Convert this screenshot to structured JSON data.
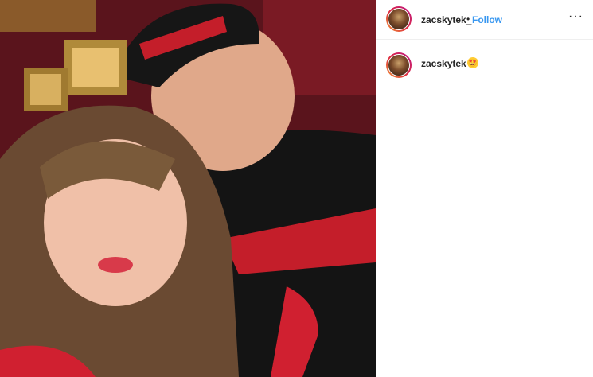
{
  "post": {
    "photo_alt": "selfie",
    "author": {
      "username": "zacskytek_",
      "separator": "•",
      "follow_label": "Follow",
      "more_icon": "more-horizontal-icon",
      "more_label": "···"
    },
    "caption": {
      "username": "zacskytek_",
      "emoji": "🤩",
      "emoji_icon": "star-struck-emoji-icon"
    },
    "colors": {
      "follow": "#3897f0",
      "text": "#262626",
      "border": "#dbdbdb"
    }
  }
}
